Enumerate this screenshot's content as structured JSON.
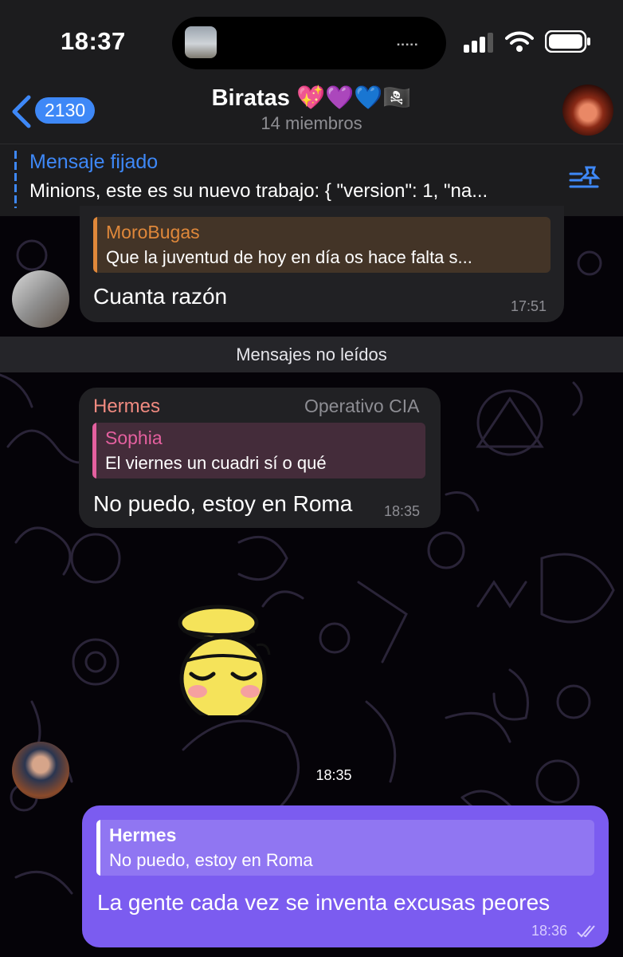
{
  "status_bar": {
    "time": "18:37"
  },
  "header": {
    "back_count": "2130",
    "title": "Biratas 💖💜💙🏴‍☠️",
    "subtitle": "14 miembros"
  },
  "pinned": {
    "label": "Mensaje fijado",
    "text": "Minions, este es su nuevo trabajo: { \"version\": 1, \"na..."
  },
  "messages": {
    "m1": {
      "reply_name": "MoroBugas",
      "reply_text": "Que la juventud de hoy en día os hace falta s...",
      "text": "Cuanta razón",
      "time": "17:51"
    },
    "unread_label": "Mensajes no leídos",
    "m2": {
      "sender": "Hermes",
      "sender_title": "Operativo CIA",
      "reply_name": "Sophia",
      "reply_text": "El viernes un cuadri sí o qué",
      "text": "No puedo, estoy en Roma",
      "time": "18:35"
    },
    "sticker_time": "18:35",
    "m3": {
      "reply_name": "Hermes",
      "reply_text": "No puedo, estoy en Roma",
      "text": "La gente cada vez se inventa excusas peores",
      "time": "18:36"
    }
  },
  "colors": {
    "accent": "#3e88f7",
    "outgoing_bubble": "#7b5cf0",
    "incoming_bubble": "#212124",
    "morobugas": "#e0883a",
    "hermes": "#f08a80",
    "sophia": "#e4609f"
  },
  "icons": [
    "back-chevron-icon",
    "pin-list-icon",
    "signal-icon",
    "wifi-icon",
    "battery-icon",
    "read-checkmarks-icon",
    "sleepy-emoji-sticker"
  ]
}
